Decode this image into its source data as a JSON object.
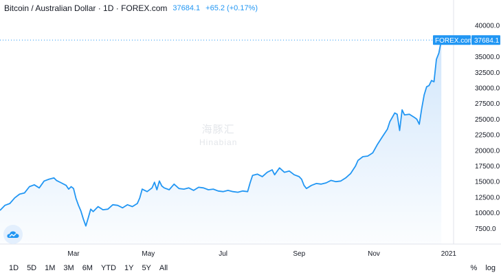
{
  "legend": {
    "title": "Bitcoin / Australian Dollar · 1D · FOREX.com",
    "last": "37684.1",
    "change": "+65.2 (+0.17%)"
  },
  "badge": {
    "source": "FOREX.com",
    "value": "37684.1"
  },
  "watermark": {
    "line1": "海豚汇",
    "line2": "Hinabian"
  },
  "toolbar": {
    "ranges": [
      "1D",
      "5D",
      "1M",
      "3M",
      "6M",
      "YTD",
      "1Y",
      "5Y",
      "All"
    ],
    "percent": "%",
    "log": "log"
  },
  "colors": {
    "line": "#2196f3",
    "fill": "#ddeefd",
    "badge": "#2196f3"
  },
  "chart_data": {
    "type": "area",
    "series_name": "Bitcoin / Australian Dollar",
    "ylim": [
      5000,
      43000
    ],
    "y_ticks": [
      7500,
      10000,
      12500,
      15000,
      17500,
      20000,
      22500,
      25000,
      27500,
      30000,
      32500,
      35000,
      40000
    ],
    "y_tick_labels": [
      "7500.0",
      "10000.0",
      "12500.0",
      "15000.0",
      "17500.0",
      "20000.0",
      "22500.0",
      "25000.0",
      "27500.0",
      "30000.0",
      "32500.0",
      "35000.0",
      "40000.0"
    ],
    "x_labels": [
      "Mar",
      "May",
      "Jul",
      "Sep",
      "Nov",
      "2021"
    ],
    "x_label_days": [
      60,
      121,
      182,
      244,
      305,
      366
    ],
    "x_range_days": [
      0,
      370
    ],
    "points": [
      [
        0,
        10400
      ],
      [
        4,
        11200
      ],
      [
        8,
        11500
      ],
      [
        12,
        12400
      ],
      [
        16,
        13000
      ],
      [
        20,
        13200
      ],
      [
        24,
        14200
      ],
      [
        28,
        14500
      ],
      [
        32,
        14000
      ],
      [
        36,
        15100
      ],
      [
        40,
        15400
      ],
      [
        44,
        15600
      ],
      [
        46,
        15200
      ],
      [
        50,
        14800
      ],
      [
        54,
        14400
      ],
      [
        56,
        13800
      ],
      [
        58,
        14200
      ],
      [
        60,
        13900
      ],
      [
        62,
        12300
      ],
      [
        64,
        11200
      ],
      [
        66,
        10300
      ],
      [
        68,
        9000
      ],
      [
        70,
        7900
      ],
      [
        72,
        9200
      ],
      [
        74,
        10600
      ],
      [
        76,
        10200
      ],
      [
        80,
        11000
      ],
      [
        84,
        10500
      ],
      [
        88,
        10600
      ],
      [
        92,
        11300
      ],
      [
        96,
        11200
      ],
      [
        100,
        10800
      ],
      [
        104,
        11300
      ],
      [
        108,
        11000
      ],
      [
        112,
        11500
      ],
      [
        114,
        12400
      ],
      [
        116,
        13800
      ],
      [
        120,
        13400
      ],
      [
        124,
        14000
      ],
      [
        126,
        14900
      ],
      [
        128,
        13700
      ],
      [
        130,
        15100
      ],
      [
        132,
        14300
      ],
      [
        134,
        14000
      ],
      [
        138,
        13700
      ],
      [
        142,
        14600
      ],
      [
        146,
        13900
      ],
      [
        150,
        13800
      ],
      [
        154,
        14000
      ],
      [
        158,
        13600
      ],
      [
        162,
        14100
      ],
      [
        166,
        14000
      ],
      [
        170,
        13700
      ],
      [
        174,
        13800
      ],
      [
        178,
        13500
      ],
      [
        182,
        13400
      ],
      [
        186,
        13600
      ],
      [
        190,
        13400
      ],
      [
        194,
        13300
      ],
      [
        198,
        13500
      ],
      [
        202,
        13400
      ],
      [
        204,
        14800
      ],
      [
        206,
        16000
      ],
      [
        210,
        16200
      ],
      [
        214,
        15800
      ],
      [
        218,
        16500
      ],
      [
        222,
        16900
      ],
      [
        224,
        16100
      ],
      [
        228,
        17200
      ],
      [
        232,
        16500
      ],
      [
        236,
        16700
      ],
      [
        240,
        16100
      ],
      [
        244,
        15800
      ],
      [
        246,
        15400
      ],
      [
        248,
        14400
      ],
      [
        250,
        13900
      ],
      [
        254,
        14400
      ],
      [
        258,
        14700
      ],
      [
        262,
        14600
      ],
      [
        266,
        14800
      ],
      [
        270,
        15200
      ],
      [
        274,
        15000
      ],
      [
        278,
        15100
      ],
      [
        282,
        15600
      ],
      [
        286,
        16300
      ],
      [
        290,
        17500
      ],
      [
        292,
        18400
      ],
      [
        296,
        19000
      ],
      [
        300,
        19100
      ],
      [
        304,
        19600
      ],
      [
        308,
        21000
      ],
      [
        312,
        22200
      ],
      [
        316,
        23400
      ],
      [
        318,
        24600
      ],
      [
        322,
        26000
      ],
      [
        324,
        25800
      ],
      [
        326,
        23200
      ],
      [
        328,
        26500
      ],
      [
        330,
        25700
      ],
      [
        334,
        25800
      ],
      [
        338,
        25300
      ],
      [
        340,
        25000
      ],
      [
        342,
        24200
      ],
      [
        344,
        26700
      ],
      [
        346,
        28900
      ],
      [
        348,
        30200
      ],
      [
        350,
        30400
      ],
      [
        352,
        31200
      ],
      [
        354,
        31000
      ],
      [
        356,
        34600
      ],
      [
        358,
        35600
      ],
      [
        360,
        37684
      ]
    ]
  }
}
